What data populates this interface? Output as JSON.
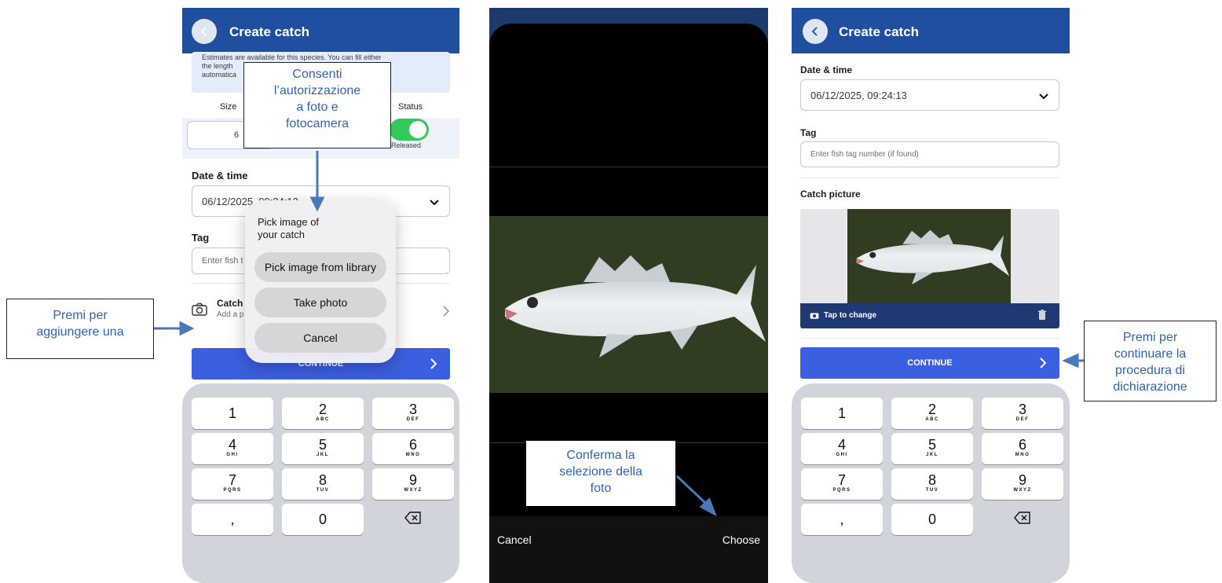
{
  "common": {
    "header_title": "Create catch",
    "date_label": "Date & time",
    "date_value": "06/12/2025, 09:24:13",
    "tag_label": "Tag",
    "tag_placeholder": "Enter fish tag number (if found)",
    "continue_label": "CONTINUE"
  },
  "screen1": {
    "estimates_text_1": "Estimates are available for this species. You can fill either",
    "estimates_text_2": "the length",
    "estimates_text_3": "automatica",
    "size_label": "Size",
    "status_label": "Status",
    "size_value": "6",
    "released_label": "Released",
    "date_value_partial": "06/12/2025, 09:24:13",
    "tag_placeholder_partial": "Enter fish t",
    "catch_picture_label": "Catch",
    "catch_picture_hint": "Add a p",
    "sheet": {
      "title_1": "Pick image of",
      "title_2": "your catch",
      "library_button": "Pick image from library",
      "take_photo_button": "Take photo",
      "cancel_button": "Cancel"
    }
  },
  "screen2": {
    "cancel_label": "Cancel",
    "choose_label": "Choose"
  },
  "screen3": {
    "catch_picture_label": "Catch picture",
    "tap_to_change": "Tap to change"
  },
  "keypad": [
    {
      "d": "1",
      "l": ""
    },
    {
      "d": "2",
      "l": "ABC"
    },
    {
      "d": "3",
      "l": "DEF"
    },
    {
      "d": "4",
      "l": "GHI"
    },
    {
      "d": "5",
      "l": "JKL"
    },
    {
      "d": "6",
      "l": "MNO"
    },
    {
      "d": "7",
      "l": "PQRS"
    },
    {
      "d": "8",
      "l": "TUV"
    },
    {
      "d": "9",
      "l": "WXYZ"
    },
    {
      "d": ",",
      "l": ""
    },
    {
      "d": "0",
      "l": ""
    },
    {
      "d": "",
      "l": ""
    }
  ],
  "callouts": {
    "permission": [
      "Consenti",
      "l’autorizzazione",
      "a foto e",
      "fotocamera"
    ],
    "add": [
      "Premi per",
      "aggiungere una"
    ],
    "confirm": [
      "Conferma la",
      "selezione della",
      "foto"
    ],
    "continue": [
      "Premi per",
      "continuare la",
      "procedura di",
      "dichiarazione"
    ]
  },
  "colors": {
    "header": "#1f4f9e",
    "button": "#3b5fe0",
    "toggle": "#34c759",
    "arrow": "#4a78b8",
    "callout_text": "#2e64b4"
  },
  "icons": [
    "back-chevron-icon",
    "chevron-down-icon",
    "camera-icon",
    "chevron-right-icon",
    "trash-icon",
    "backspace-icon"
  ]
}
